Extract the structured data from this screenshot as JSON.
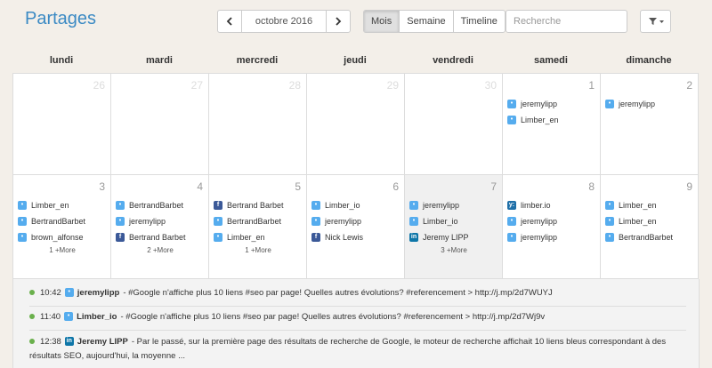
{
  "header": {
    "title": "Partages",
    "month_label": "octobre 2016",
    "views": [
      "Mois",
      "Semaine",
      "Timeline"
    ],
    "active_view": "Mois",
    "search_placeholder": "Recherche"
  },
  "weekdays": [
    "lundi",
    "mardi",
    "mercredi",
    "jeudi",
    "vendredi",
    "samedi",
    "dimanche"
  ],
  "colors": {
    "twitter": "#55acee",
    "facebook": "#3b5998",
    "linkedin": "#0e76a8",
    "limber": "#1e6fa8",
    "title": "#3b8ac4",
    "status": "#6ab04c"
  },
  "weeks": [
    [
      {
        "day": "26",
        "out": true,
        "entries": []
      },
      {
        "day": "27",
        "out": true,
        "entries": []
      },
      {
        "day": "28",
        "out": true,
        "entries": []
      },
      {
        "day": "29",
        "out": true,
        "entries": []
      },
      {
        "day": "30",
        "out": true,
        "entries": []
      },
      {
        "day": "1",
        "entries": [
          {
            "icon": "twitter",
            "name": "jeremylipp"
          },
          {
            "icon": "twitter",
            "name": "Limber_en"
          }
        ]
      },
      {
        "day": "2",
        "entries": [
          {
            "icon": "twitter",
            "name": "jeremylipp"
          }
        ]
      }
    ],
    [
      {
        "day": "3",
        "entries": [
          {
            "icon": "twitter",
            "name": "Limber_en"
          },
          {
            "icon": "twitter",
            "name": "BertrandBarbet"
          },
          {
            "icon": "twitter",
            "name": "brown_alfonse"
          }
        ],
        "more": "1 +More"
      },
      {
        "day": "4",
        "entries": [
          {
            "icon": "twitter",
            "name": "BertrandBarbet"
          },
          {
            "icon": "twitter",
            "name": "jeremylipp"
          },
          {
            "icon": "facebook",
            "name": "Bertrand Barbet"
          }
        ],
        "more": "2 +More"
      },
      {
        "day": "5",
        "entries": [
          {
            "icon": "facebook",
            "name": "Bertrand Barbet"
          },
          {
            "icon": "twitter",
            "name": "BertrandBarbet"
          },
          {
            "icon": "twitter",
            "name": "Limber_en"
          }
        ],
        "more": "1 +More"
      },
      {
        "day": "6",
        "entries": [
          {
            "icon": "twitter",
            "name": "Limber_io"
          },
          {
            "icon": "twitter",
            "name": "jeremylipp"
          },
          {
            "icon": "facebook",
            "name": "Nick Lewis"
          }
        ]
      },
      {
        "day": "7",
        "today": true,
        "entries": [
          {
            "icon": "twitter",
            "name": "jeremylipp"
          },
          {
            "icon": "twitter",
            "name": "Limber_io"
          },
          {
            "icon": "linkedin",
            "name": "Jeremy LIPP"
          }
        ],
        "more": "3 +More"
      },
      {
        "day": "8",
        "entries": [
          {
            "icon": "limber",
            "name": "limber.io"
          },
          {
            "icon": "twitter",
            "name": "jeremylipp"
          },
          {
            "icon": "twitter",
            "name": "jeremylipp"
          }
        ]
      },
      {
        "day": "9",
        "entries": [
          {
            "icon": "twitter",
            "name": "Limber_en"
          },
          {
            "icon": "twitter",
            "name": "Limber_en"
          },
          {
            "icon": "twitter",
            "name": "BertrandBarbet"
          }
        ]
      }
    ]
  ],
  "feed": [
    {
      "time": "10:42",
      "icon": "twitter",
      "author": "jeremylipp",
      "message": "- #Google n'affiche plus 10 liens #seo par page! Quelles autres évolutions? #referencement > http://j.mp/2d7WUYJ"
    },
    {
      "time": "11:40",
      "icon": "twitter",
      "author": "Limber_io",
      "message": "- #Google n'affiche plus 10 liens #seo par page! Quelles autres évolutions? #referencement > http://j.mp/2d7Wj9v"
    },
    {
      "time": "12:38",
      "icon": "linkedin",
      "author": "Jeremy LIPP",
      "message": "- Par le passé, sur la première page des résultats de recherche de Google, le moteur de recherche affichait 10 liens bleus correspondant à des résultats SEO, aujourd'hui, la moyenne ..."
    }
  ]
}
